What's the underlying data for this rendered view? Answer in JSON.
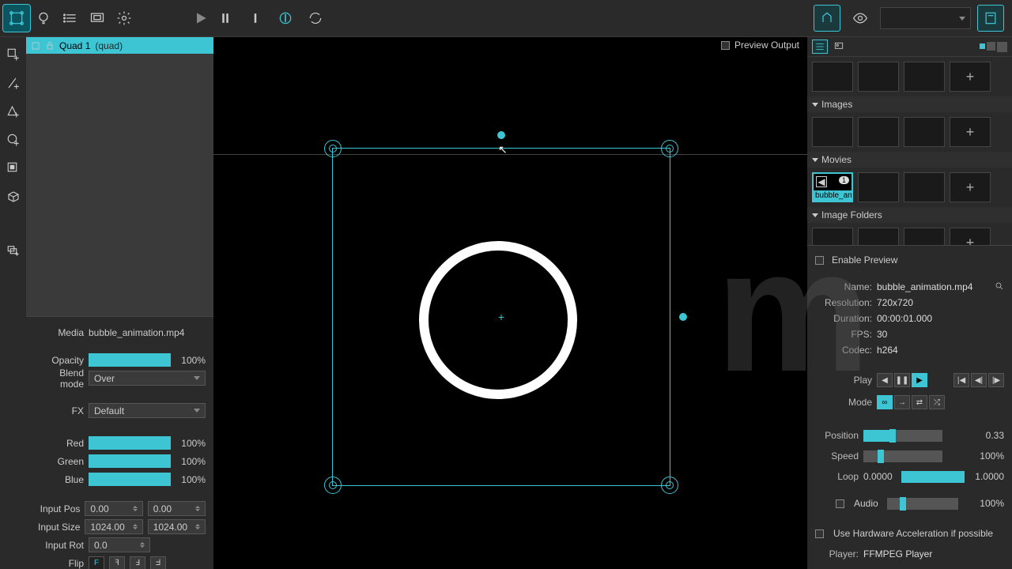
{
  "layer": {
    "name": "Quad 1",
    "type": "(quad)"
  },
  "preview_output_label": "Preview Output",
  "props": {
    "media_label": "Media",
    "media_name": "bubble_animation.mp4",
    "opacity_label": "Opacity",
    "opacity_pct": "100%",
    "blend_label": "Blend mode",
    "blend_value": "Over",
    "fx_label": "FX",
    "fx_value": "Default",
    "red_label": "Red",
    "red_pct": "100%",
    "green_label": "Green",
    "green_pct": "100%",
    "blue_label": "Blue",
    "blue_pct": "100%",
    "input_pos_label": "Input Pos",
    "input_pos_x": "0.00",
    "input_pos_y": "0.00",
    "input_size_label": "Input Size",
    "input_size_w": "1024.00",
    "input_size_h": "1024.00",
    "input_rot_label": "Input Rot",
    "input_rot": "0.0",
    "flip_label": "Flip"
  },
  "library": {
    "images_label": "Images",
    "movies_label": "Movies",
    "image_folders_label": "Image Folders",
    "movie_thumb_label": "bubble_an",
    "movie_badge": "1"
  },
  "inspector": {
    "enable_preview_label": "Enable Preview",
    "name_label": "Name:",
    "name_value": "bubble_animation.mp4",
    "resolution_label": "Resolution:",
    "resolution_value": "720x720",
    "duration_label": "Duration:",
    "duration_value": "00:00:01.000",
    "fps_label": "FPS:",
    "fps_value": "30",
    "codec_label": "Codec:",
    "codec_value": "h264",
    "play_label": "Play",
    "mode_label": "Mode",
    "position_label": "Position",
    "position_value": "0.33",
    "speed_label": "Speed",
    "speed_value": "100%",
    "loop_label": "Loop",
    "loop_start": "0.0000",
    "loop_end": "1.0000",
    "audio_label": "Audio",
    "audio_value": "100%",
    "hw_accel_label": "Use Hardware Acceleration if possible",
    "player_label": "Player:",
    "player_value": "FFMPEG Player"
  }
}
